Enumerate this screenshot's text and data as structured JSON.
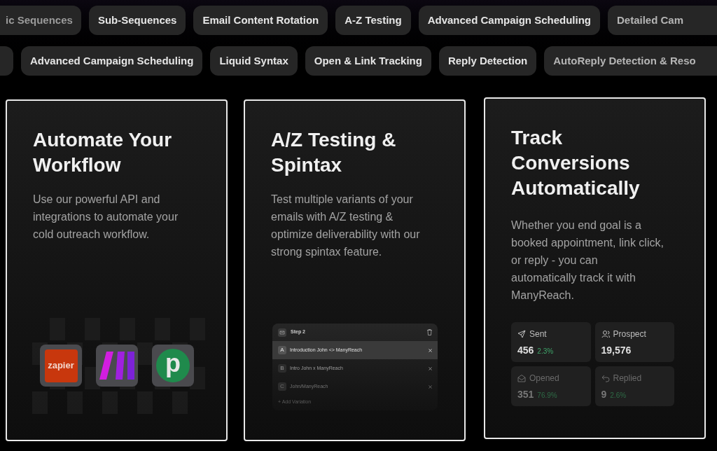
{
  "chip_rows": [
    [
      "ic Sequences",
      "Sub-Sequences",
      "Email Content Rotation",
      "A-Z Testing",
      "Advanced Campaign Scheduling",
      "Detailed Cam"
    ],
    [
      "",
      "Advanced Campaign Scheduling",
      "Liquid Syntax",
      "Open & Link Tracking",
      "Reply Detection",
      "AutoReply Detection & Reso"
    ]
  ],
  "cards": [
    {
      "kind": "integrations",
      "title": "Automate Your Workflow",
      "description": "Use our powerful API and integrations to automate your cold outreach workflow.",
      "logos": [
        {
          "kind": "zapier",
          "text": "zapier"
        },
        {
          "kind": "make"
        },
        {
          "kind": "pabbly",
          "text": "p"
        }
      ]
    },
    {
      "kind": "variants",
      "title": "A/Z Testing & Spintax",
      "description": "Test multiple variants of your emails with A/Z testing & optimize deliverability with our strong spintax feature.",
      "panel": {
        "step": "Step 2",
        "variants": [
          {
            "letter": "A",
            "subject": "Introduction John <> ManyReach",
            "selected": true
          },
          {
            "letter": "B",
            "subject": "Intro John x ManyReach",
            "selected": false
          },
          {
            "letter": "C",
            "subject": "John/ManyReach",
            "selected": false
          }
        ],
        "add": "+ Add Variation"
      }
    },
    {
      "kind": "stats",
      "title": "Track Conversions Automatically",
      "description": "Whether you end goal is a booked appointment, link click, or reply - you can automatically track it with ManyReach.",
      "stats": [
        {
          "kind": "send",
          "label": "Sent",
          "value": "456",
          "change": "2.3%"
        },
        {
          "kind": "user",
          "label": "Prospect",
          "value": "19,576"
        },
        {
          "kind": "mail",
          "label": "Opened",
          "value": "351",
          "change": "76.9%"
        },
        {
          "kind": "reply",
          "label": "Replied",
          "value": "9",
          "change": "2.6%"
        }
      ]
    }
  ]
}
